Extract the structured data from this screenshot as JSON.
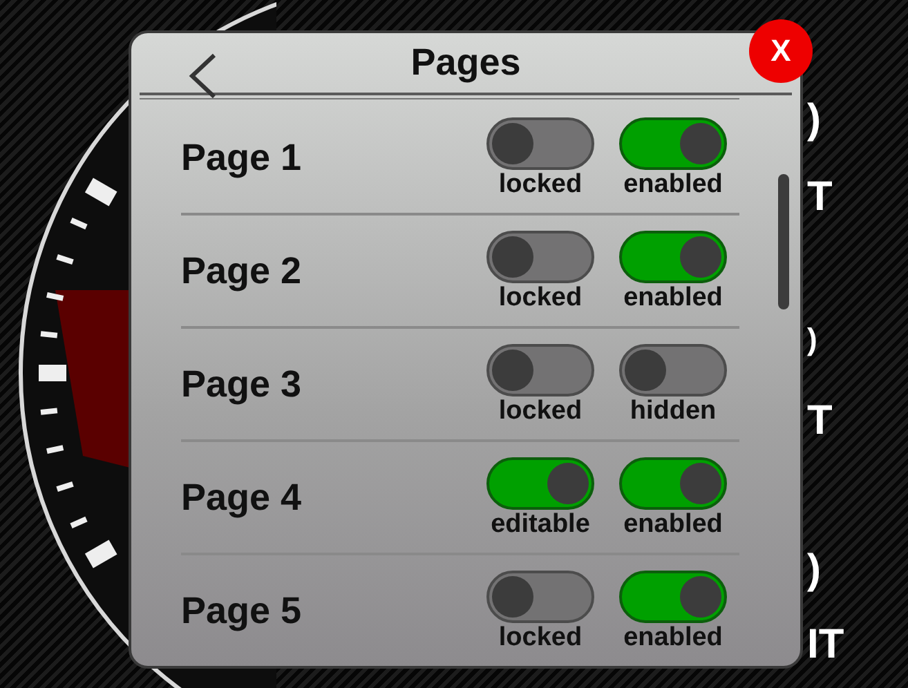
{
  "background_fragments": [
    ")",
    "T",
    ")",
    "T",
    ")",
    "IT"
  ],
  "dialog": {
    "title": "Pages",
    "close_label": "X",
    "pages": [
      {
        "name": "Page 1",
        "toggles": [
          {
            "label": "locked",
            "on": false
          },
          {
            "label": "enabled",
            "on": true
          }
        ]
      },
      {
        "name": "Page 2",
        "toggles": [
          {
            "label": "locked",
            "on": false
          },
          {
            "label": "enabled",
            "on": true
          }
        ]
      },
      {
        "name": "Page 3",
        "toggles": [
          {
            "label": "locked",
            "on": false
          },
          {
            "label": "hidden",
            "on": false
          }
        ]
      },
      {
        "name": "Page 4",
        "toggles": [
          {
            "label": "editable",
            "on": true
          },
          {
            "label": "enabled",
            "on": true
          }
        ]
      },
      {
        "name": "Page 5",
        "toggles": [
          {
            "label": "locked",
            "on": false
          },
          {
            "label": "enabled",
            "on": true
          }
        ]
      }
    ]
  }
}
